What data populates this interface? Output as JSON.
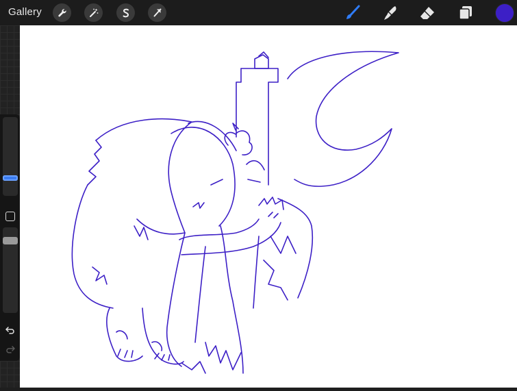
{
  "topbar": {
    "gallery_label": "Gallery",
    "left_tools": [
      {
        "icon": "wrench-icon"
      },
      {
        "icon": "magic-wand-icon"
      },
      {
        "icon": "selection-s-icon"
      },
      {
        "icon": "transform-arrow-icon"
      }
    ],
    "right_tools": [
      {
        "icon": "brush-icon",
        "active": true
      },
      {
        "icon": "smudge-icon"
      },
      {
        "icon": "eraser-icon"
      },
      {
        "icon": "layers-icon"
      }
    ],
    "current_color": "#3c1fc6",
    "active_tool_color": "#2f7cf6"
  },
  "sidebar": {
    "brush_size_slider": {
      "icon": "brush-size-slider"
    },
    "modify_button": {
      "icon": "square-icon"
    },
    "opacity_slider": {
      "icon": "opacity-slider"
    },
    "undo": {
      "icon": "undo-icon"
    },
    "redo": {
      "icon": "redo-icon"
    }
  },
  "canvas": {
    "background": "#ffffff",
    "stroke_color": "#3c1fc6"
  }
}
